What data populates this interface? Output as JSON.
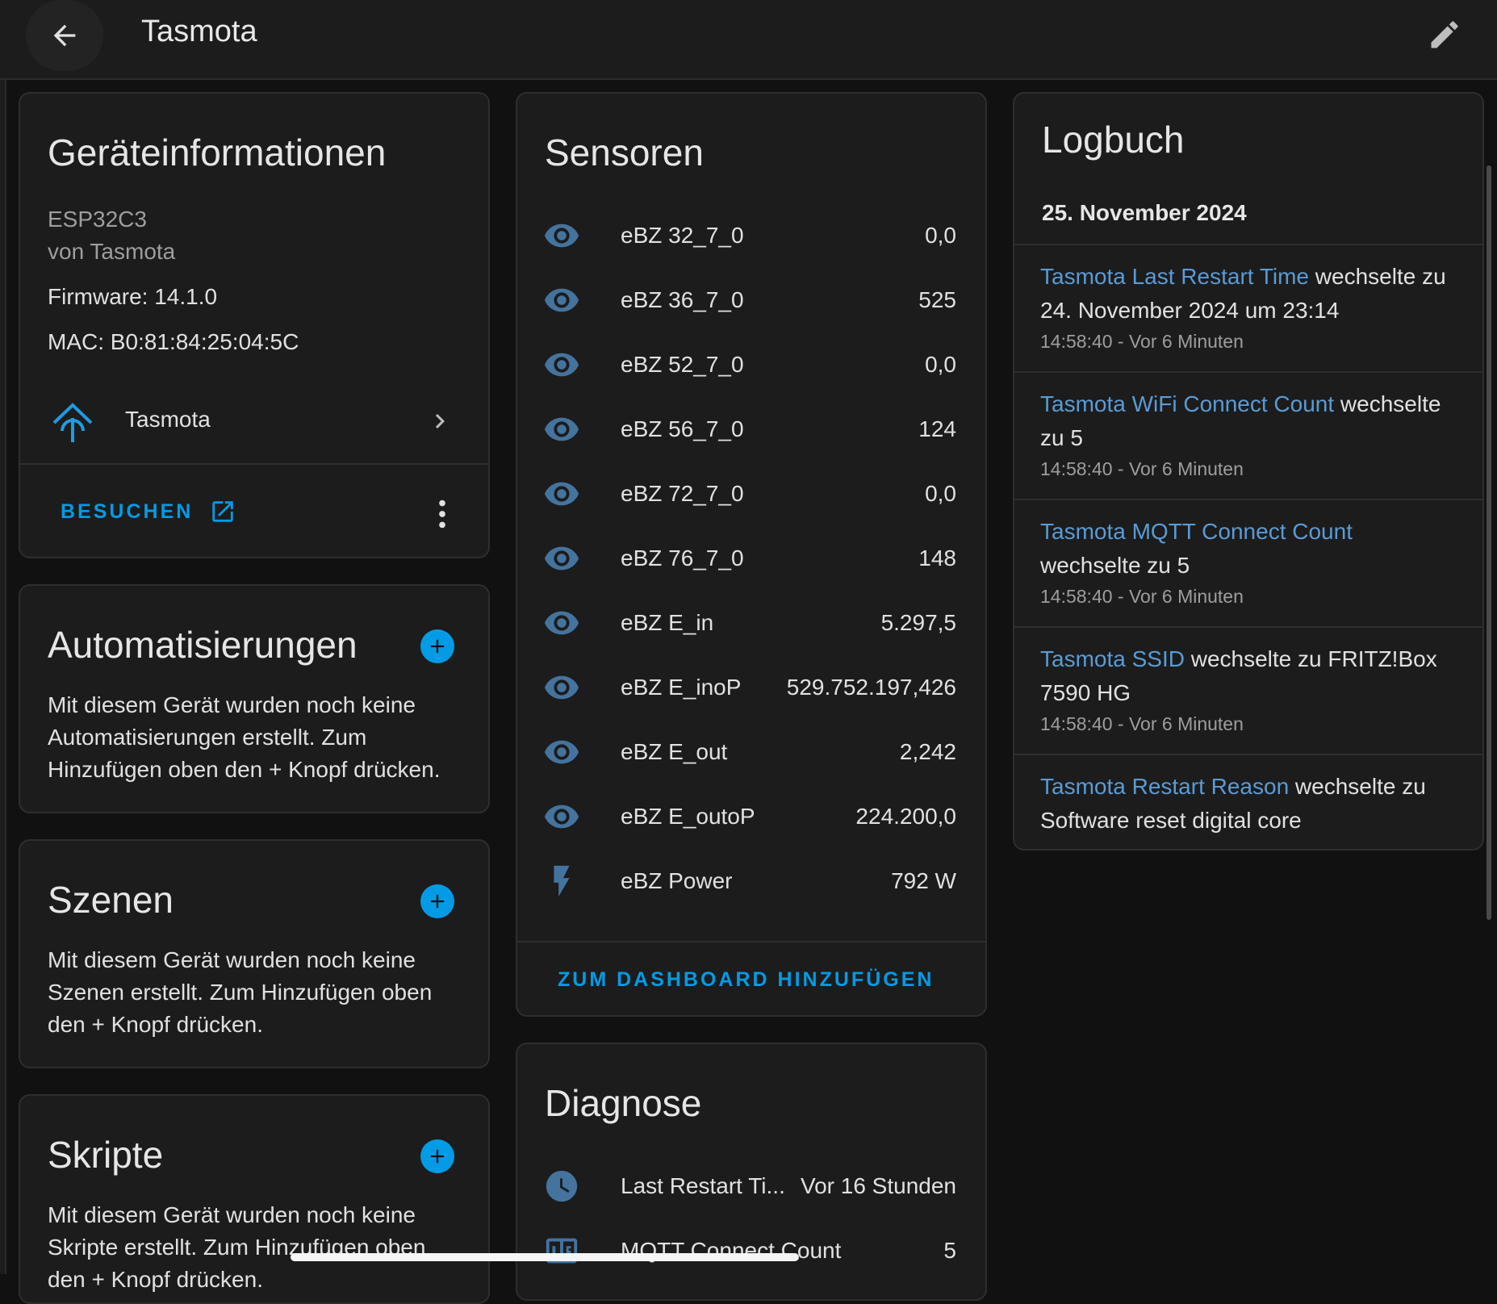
{
  "header": {
    "title": "Tasmota",
    "back_icon": "arrow-left-icon",
    "edit_icon": "pencil-icon"
  },
  "device_info": {
    "title": "Geräteinformationen",
    "model": "ESP32C3",
    "manufacturer": "von Tasmota",
    "firmware": "Firmware: 14.1.0",
    "mac": "MAC: B0:81:84:25:04:5C",
    "integration": "Tasmota",
    "visit_label": "BESUCHEN"
  },
  "automations": {
    "title": "Automatisierungen",
    "text": "Mit diesem Gerät wurden noch keine Automatisierungen erstellt. Zum Hinzufügen oben den + Knopf drücken."
  },
  "scenes": {
    "title": "Szenen",
    "text": "Mit diesem Gerät wurden noch keine Szenen erstellt. Zum Hinzufügen oben den + Knopf drücken."
  },
  "scripts": {
    "title": "Skripte",
    "text": "Mit diesem Gerät wurden noch keine Skripte erstellt. Zum Hinzufügen oben den + Knopf drücken."
  },
  "sensors": {
    "title": "Sensoren",
    "items": [
      {
        "name": "eBZ 32_7_0",
        "value": "0,0",
        "icon": "eye-icon"
      },
      {
        "name": "eBZ 36_7_0",
        "value": "525",
        "icon": "eye-icon"
      },
      {
        "name": "eBZ 52_7_0",
        "value": "0,0",
        "icon": "eye-icon"
      },
      {
        "name": "eBZ 56_7_0",
        "value": "124",
        "icon": "eye-icon"
      },
      {
        "name": "eBZ 72_7_0",
        "value": "0,0",
        "icon": "eye-icon"
      },
      {
        "name": "eBZ 76_7_0",
        "value": "148",
        "icon": "eye-icon"
      },
      {
        "name": "eBZ E_in",
        "value": "5.297,5",
        "icon": "eye-icon"
      },
      {
        "name": "eBZ E_inoP",
        "value": "529.752.197,426",
        "icon": "eye-icon"
      },
      {
        "name": "eBZ E_out",
        "value": "2,242",
        "icon": "eye-icon"
      },
      {
        "name": "eBZ E_outoP",
        "value": "224.200,0",
        "icon": "eye-icon"
      },
      {
        "name": "eBZ Power",
        "value": "792 W",
        "icon": "flash-icon"
      }
    ],
    "add_label": "ZUM DASHBOARD HINZUFÜGEN"
  },
  "diagnostics": {
    "title": "Diagnose",
    "items": [
      {
        "name": "Last Restart Ti...",
        "value": "Vor 16 Stunden",
        "icon": "clock-icon"
      },
      {
        "name": "MQTT Connect Count",
        "value": "5",
        "icon": "counter-icon"
      }
    ]
  },
  "logbook": {
    "title": "Logbuch",
    "date": "25. November 2024",
    "entries": [
      {
        "entity": "Tasmota Last Restart Time",
        "text": " wechselte zu 24. November 2024 um 23:14",
        "time": "14:58:40 - Vor 6 Minuten"
      },
      {
        "entity": "Tasmota WiFi Connect Count",
        "text": " wechselte zu 5",
        "time": "14:58:40 - Vor 6 Minuten"
      },
      {
        "entity": "Tasmota MQTT Connect Count",
        "text": " wechselte zu 5",
        "time": "14:58:40 - Vor 6 Minuten"
      },
      {
        "entity": "Tasmota SSID",
        "text": " wechselte zu FRITZ!Box 7590 HG",
        "time": "14:58:40 - Vor 6 Minuten"
      },
      {
        "entity": "Tasmota Restart Reason",
        "text": " wechselte zu Software reset digital core",
        "time": ""
      }
    ]
  },
  "colors": {
    "accent": "#039be5",
    "icon": "#44739e",
    "log_link": "#5a9bd5",
    "card": "#1c1c1c"
  }
}
